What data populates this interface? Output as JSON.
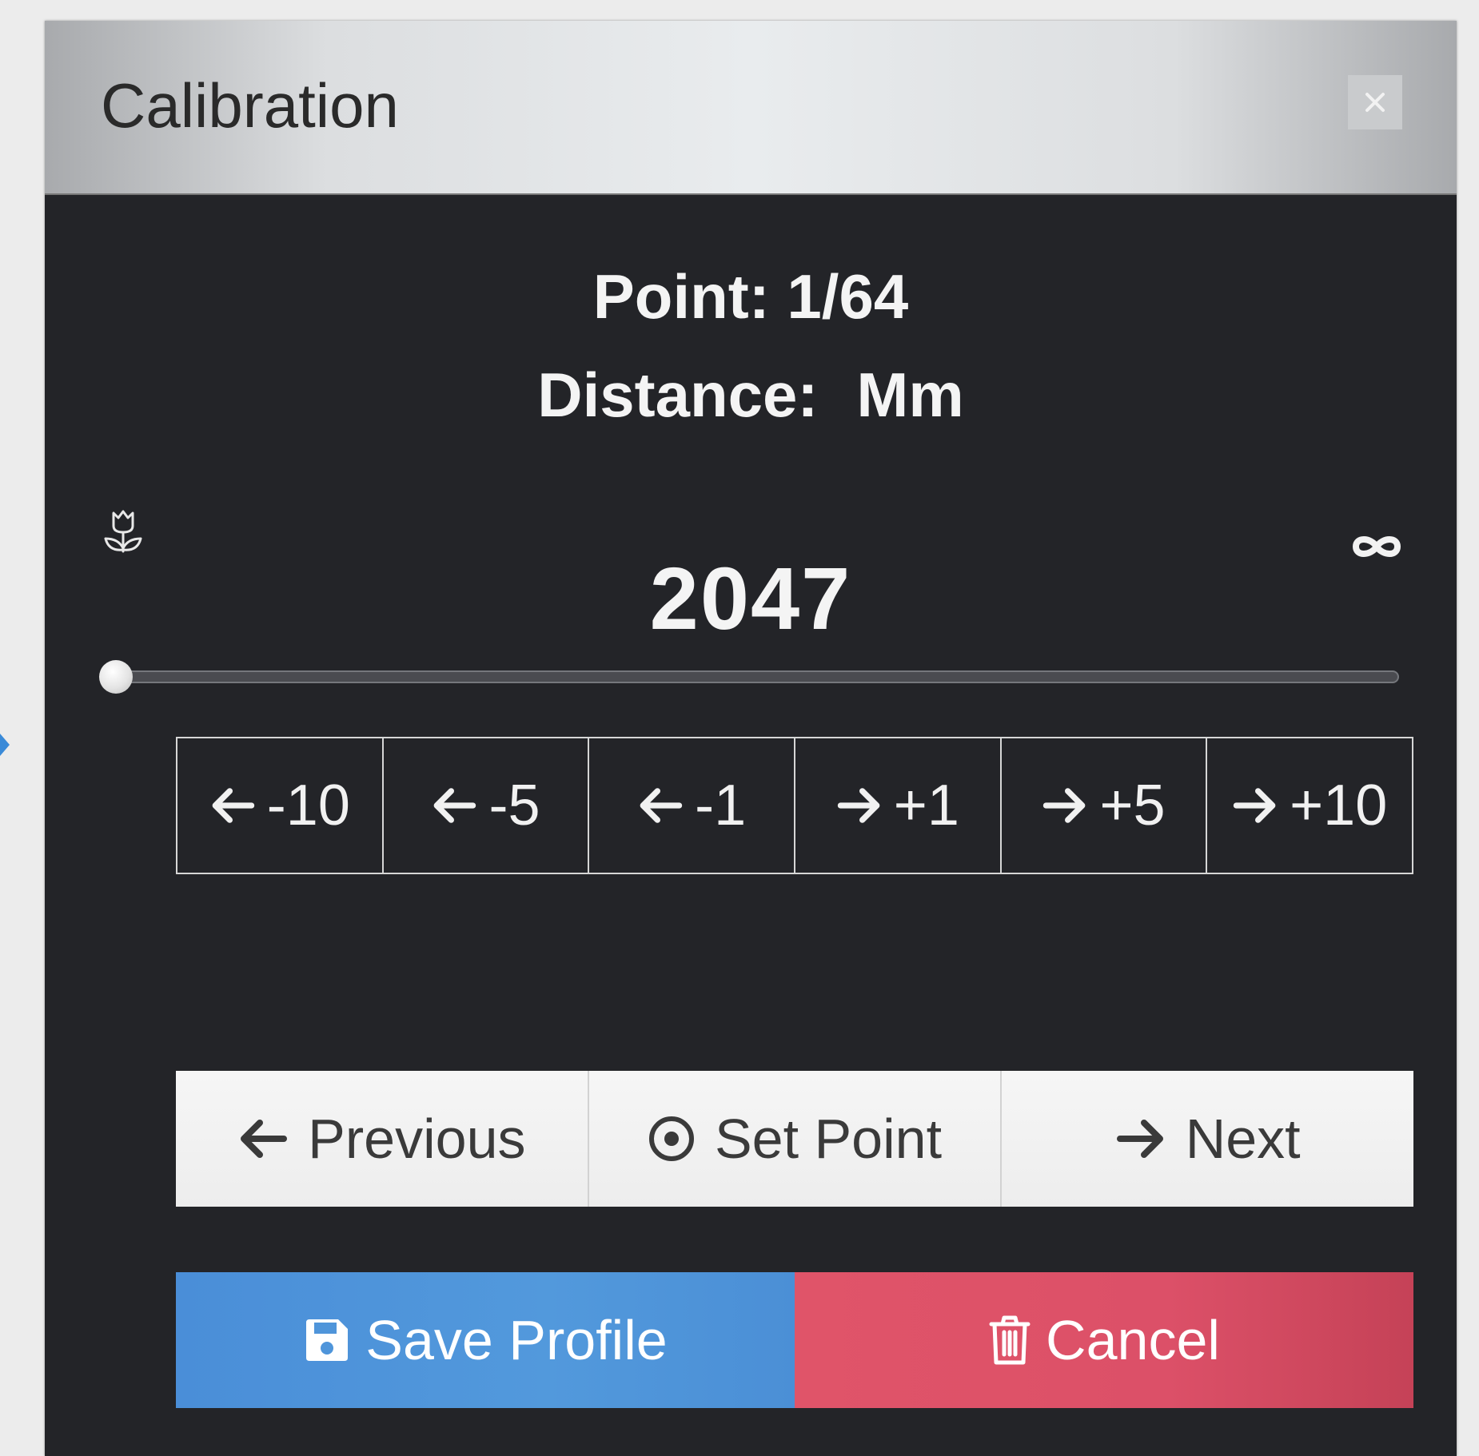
{
  "dialog": {
    "title": "Calibration",
    "close_label": "×"
  },
  "info": {
    "point_label": "Point:",
    "point_value": "1/64",
    "distance_label": "Distance:",
    "distance_value": "Mm"
  },
  "focus": {
    "value": "2047",
    "near_icon": "macro-flower-icon",
    "far_icon": "infinity-icon",
    "slider_position": 0
  },
  "steps": [
    {
      "icon": "arrow-left-icon",
      "label": "-10"
    },
    {
      "icon": "arrow-left-icon",
      "label": "-5"
    },
    {
      "icon": "arrow-left-icon",
      "label": "-1"
    },
    {
      "icon": "arrow-right-icon",
      "label": "+1"
    },
    {
      "icon": "arrow-right-icon",
      "label": "+5"
    },
    {
      "icon": "arrow-right-icon",
      "label": "+10"
    }
  ],
  "nav": {
    "previous_label": "Previous",
    "set_point_label": "Set Point",
    "next_label": "Next"
  },
  "actions": {
    "save_label": "Save Profile",
    "cancel_label": "Cancel"
  },
  "colors": {
    "panel_bg": "#232428",
    "save": "#4f95da",
    "cancel": "#de5268"
  }
}
